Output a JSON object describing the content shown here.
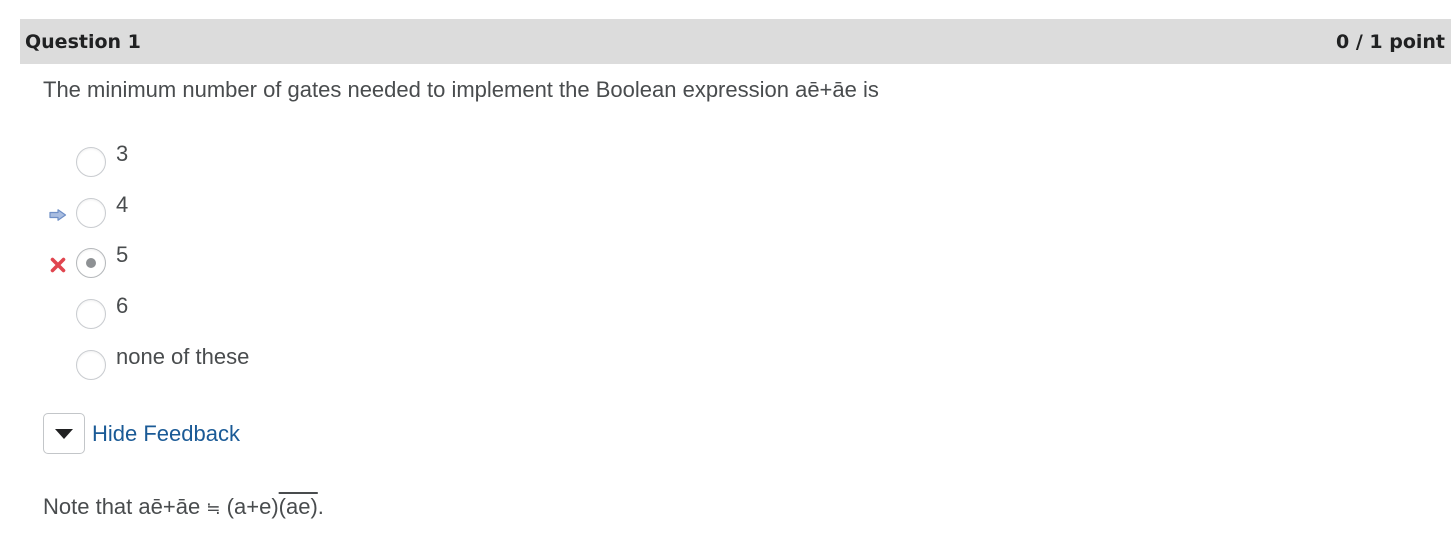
{
  "question": {
    "title": "Question 1",
    "points": "0 / 1 point",
    "text": "The minimum number of gates needed to implement the Boolean expression aē+āe is"
  },
  "options": [
    {
      "label": "3",
      "selected": false,
      "marker": ""
    },
    {
      "label": "4",
      "selected": false,
      "marker": "correct-arrow"
    },
    {
      "label": "5",
      "selected": true,
      "marker": "incorrect-x"
    },
    {
      "label": "6",
      "selected": false,
      "marker": ""
    },
    {
      "label": "none of these",
      "selected": false,
      "marker": ""
    }
  ],
  "feedback": {
    "toggle_label": "Hide Feedback",
    "note_prefix": "Note that aē+āe ",
    "note_symbol": "≒",
    "note_expr": " (a+e)",
    "note_overlined": "(ae)",
    "note_suffix": "."
  },
  "colors": {
    "header_bg": "#dcdcdc",
    "link": "#1a5a96",
    "correct_arrow": "#6f8fc6",
    "incorrect_x": "#e0454f"
  },
  "icons": {
    "correct": "arrow-right-icon",
    "incorrect": "x-icon",
    "toggle": "caret-down-icon"
  }
}
